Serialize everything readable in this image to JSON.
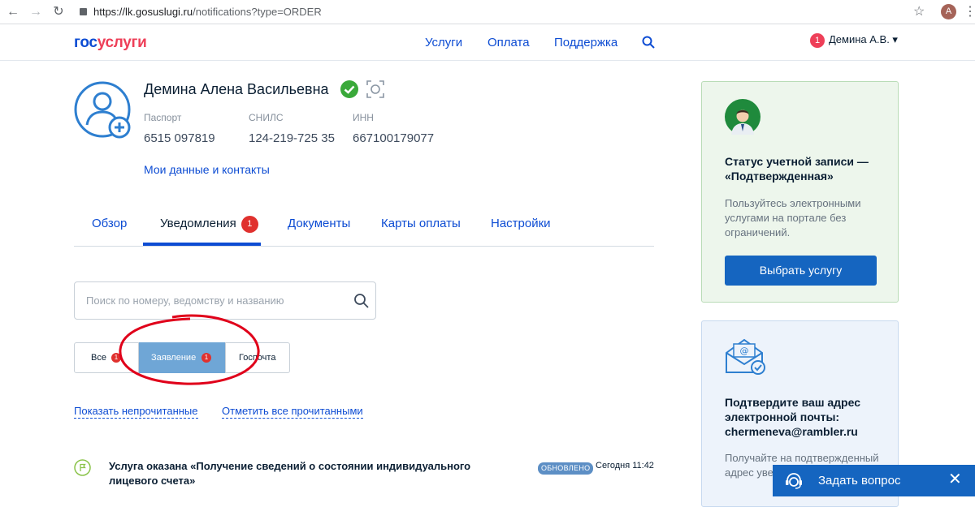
{
  "browser": {
    "back": "←",
    "forward": "→",
    "reload": "↻",
    "url_host": "https://lk.gosuslugi.ru",
    "url_path": "/notifications?type=ORDER",
    "star": "☆",
    "profile_initial": "A",
    "menu": "⋮"
  },
  "header": {
    "logo_part1": "гос",
    "logo_part2": "услуги",
    "nav": [
      "Услуги",
      "Оплата",
      "Поддержка"
    ],
    "user_badge": "1",
    "user_name": "Демина А.В. ▾"
  },
  "profile": {
    "full_name": "Демина Алена Васильевна",
    "fields": [
      {
        "label": "Паспорт",
        "value": "6515 097819"
      },
      {
        "label": "СНИЛС",
        "value": "124-219-725 35"
      },
      {
        "label": "ИНН",
        "value": "667100179077"
      }
    ],
    "my_data_link": "Мои данные и контакты"
  },
  "tabs": {
    "items": [
      "Обзор",
      "Уведомления",
      "Документы",
      "Карты оплаты",
      "Настройки"
    ],
    "notifications_badge": "1"
  },
  "search": {
    "placeholder": "Поиск по номеру, ведомству и названию"
  },
  "filters": {
    "all": "Все",
    "all_badge": "1",
    "application": "Заявление",
    "application_badge": "1",
    "mail": "Госпочта"
  },
  "actions": {
    "show_unread": "Показать непрочитанные",
    "mark_all_read": "Отметить все прочитанными"
  },
  "notification": {
    "title": "Услуга оказана «Получение сведений о состоянии индивидуального лицевого счета»",
    "status": "ОБНОВЛЕНО",
    "time": "Сегодня 11:42"
  },
  "sidebar": {
    "account_status": {
      "title": "Статус учетной записи — «Подтвержденная»",
      "text": "Пользуйтесь электронными услугами на портале без ограничений.",
      "button": "Выбрать услугу"
    },
    "email_confirm": {
      "title": "Подтвердите ваш адрес электронной почты: chermeneva@rambler.ru",
      "text": "Получайте на подтвержденный адрес уведомления"
    }
  },
  "chat": {
    "label": "Задать вопрос",
    "close": "✕"
  },
  "colors": {
    "brand_blue": "#0d4cd3",
    "brand_red": "#ee3f58",
    "badge_red": "#e0312e",
    "selected_filter": "#6fa6d6",
    "annotation_red": "#e0001a"
  }
}
